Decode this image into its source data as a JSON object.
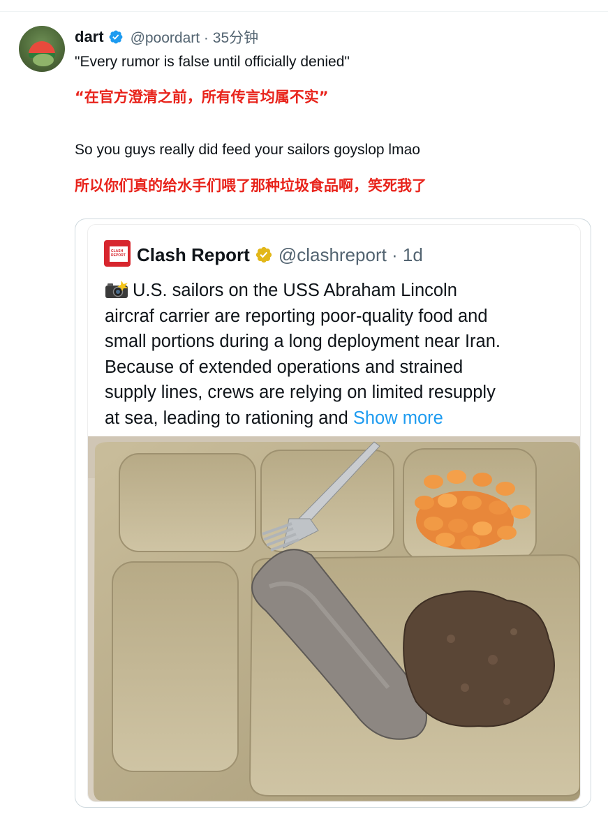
{
  "tweet": {
    "author_name": "dart",
    "handle_time": "@poordart · 35分钟",
    "line1_en": "\"Every rumor is false until officially denied\"",
    "line1_zh": "“在官方澄清之前，所有传言均属不实”",
    "line2_en": "So you guys really did feed your sailors goyslop lmao",
    "line2_zh": "所以你们真的给水手们喂了那种垃圾食品啊，笑死我了"
  },
  "quoted": {
    "logo_text": "CLASH REPORT",
    "author_name": "Clash Report",
    "handle_time": "@clashreport · 1d",
    "body_lines": [
      "U.S. sailors on the USS Abraham Lincoln",
      "aircraf carrier are reporting poor-quality food and",
      "small portions during a long deployment near Iran.",
      "Because of extended operations and strained",
      "supply lines, crews are relying on limited resupply"
    ],
    "body_last": "at sea, leading to rationing and ",
    "show_more": "Show more"
  },
  "icons": {
    "verified": "verified-badge-icon",
    "gold_badge": "gold-verified-badge-icon",
    "camera": "camera-flash-icon"
  },
  "colors": {
    "link": "#1d9bf0",
    "translation": "#e8231b",
    "handle": "#536471",
    "brand": "#d7262e"
  }
}
